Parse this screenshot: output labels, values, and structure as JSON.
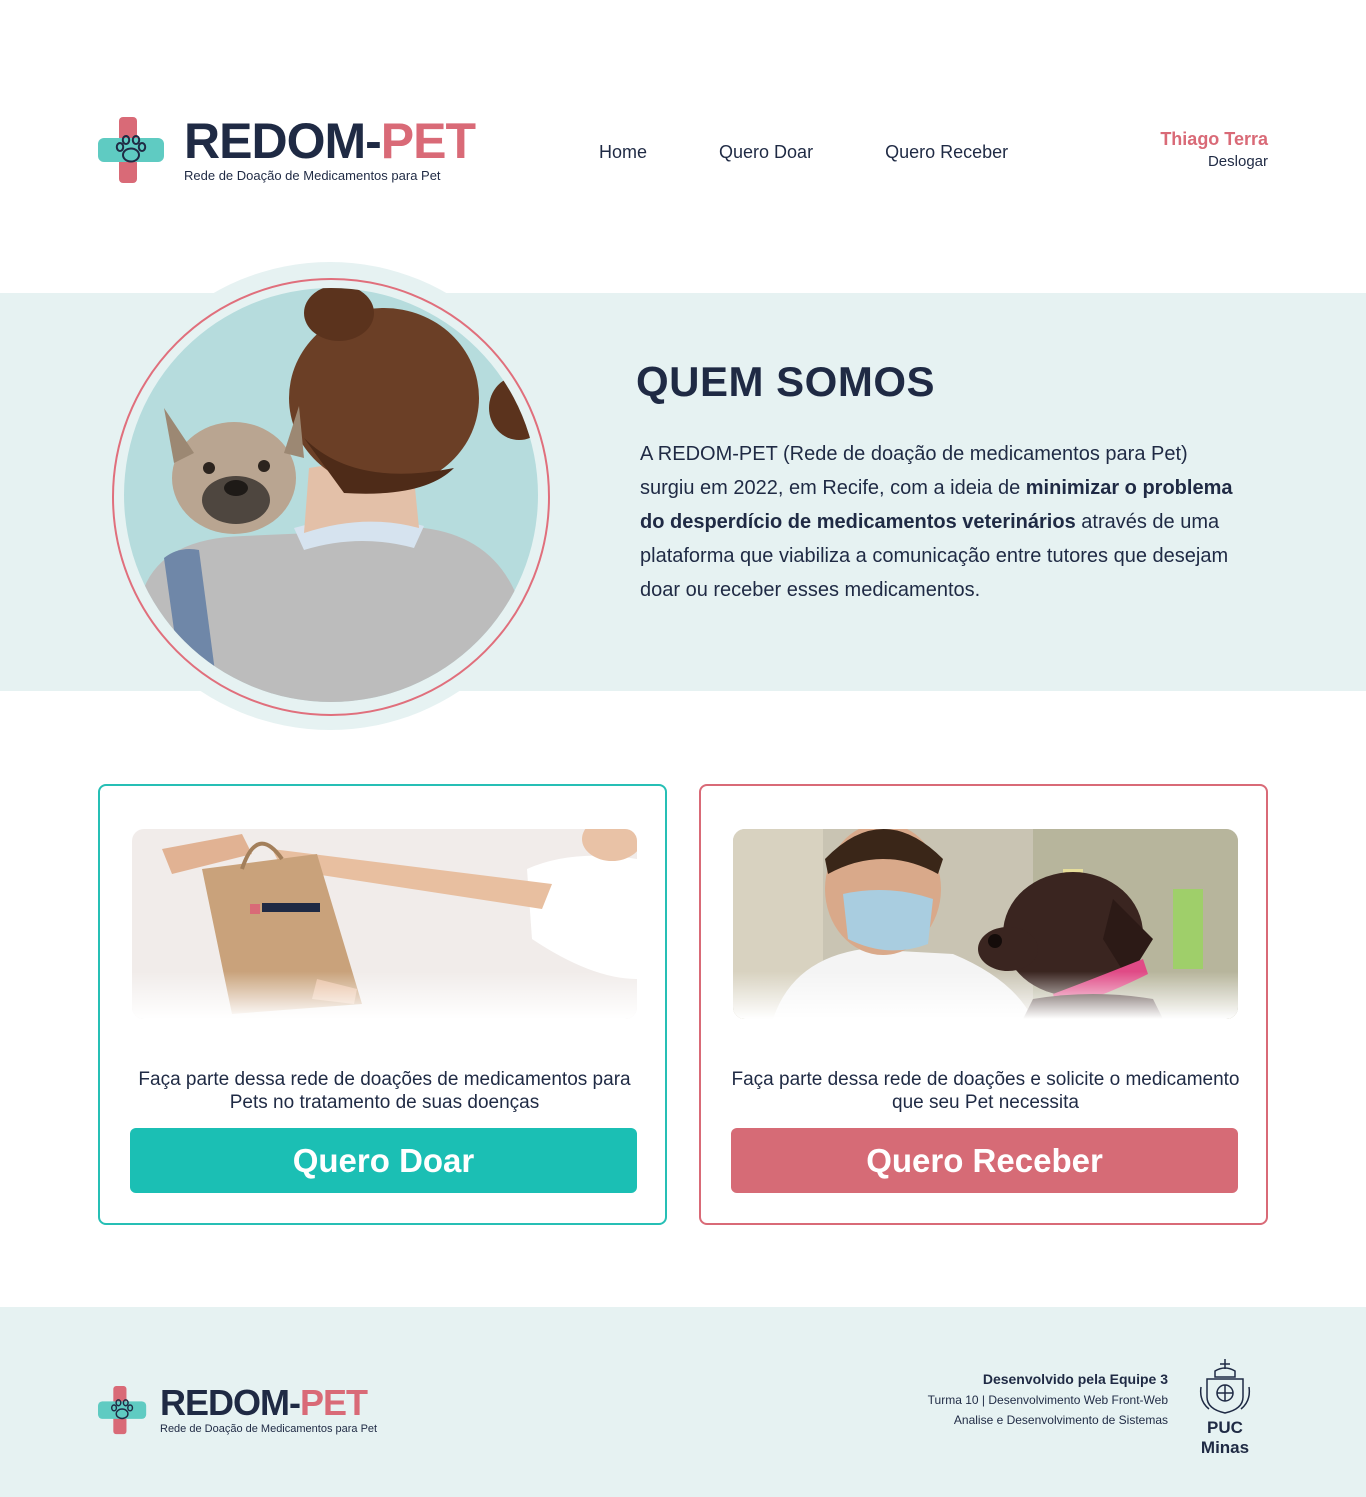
{
  "brand": {
    "name_part1": "REDOM-",
    "name_part2": "PET",
    "tagline": "Rede de Doação de Medicamentos para Pet"
  },
  "nav": {
    "items": [
      {
        "label": "Home"
      },
      {
        "label": "Quero Doar"
      },
      {
        "label": "Quero Receber"
      }
    ]
  },
  "user": {
    "name": "Thiago Terra",
    "logout_label": "Deslogar"
  },
  "about": {
    "title": "QUEM SOMOS",
    "text_1": "A REDOM-PET (Rede de doação de medicamentos para Pet) surgiu em 2022, em Recife, com a ideia de ",
    "text_bold": "minimizar o problema do desperdício de medicamentos veterinários",
    "text_2": " através de uma plataforma que viabiliza a comunicação entre tutores que desejam doar ou receber esses medicamentos."
  },
  "cards": {
    "doar": {
      "text": "Faça parte dessa rede de doações de medicamentos para Pets no tratamento de suas doenças",
      "button_label": "Quero Doar"
    },
    "receber": {
      "text": "Faça parte dessa rede de doações e solicite o medicamento que seu Pet necessita",
      "button_label": "Quero Receber"
    }
  },
  "footer": {
    "credits_line1": "Desenvolvido pela Equipe 3",
    "credits_line2": "Turma 10 | Desenvolvimento Web Front-Web",
    "credits_line3": "Analise e Desenvolvimento de Sistemas",
    "institution": "PUC Minas"
  },
  "colors": {
    "navy": "#1f2a44",
    "coral": "#d96a77",
    "teal": "#1bbfb4",
    "light_teal_bg": "#e6f2f2"
  }
}
